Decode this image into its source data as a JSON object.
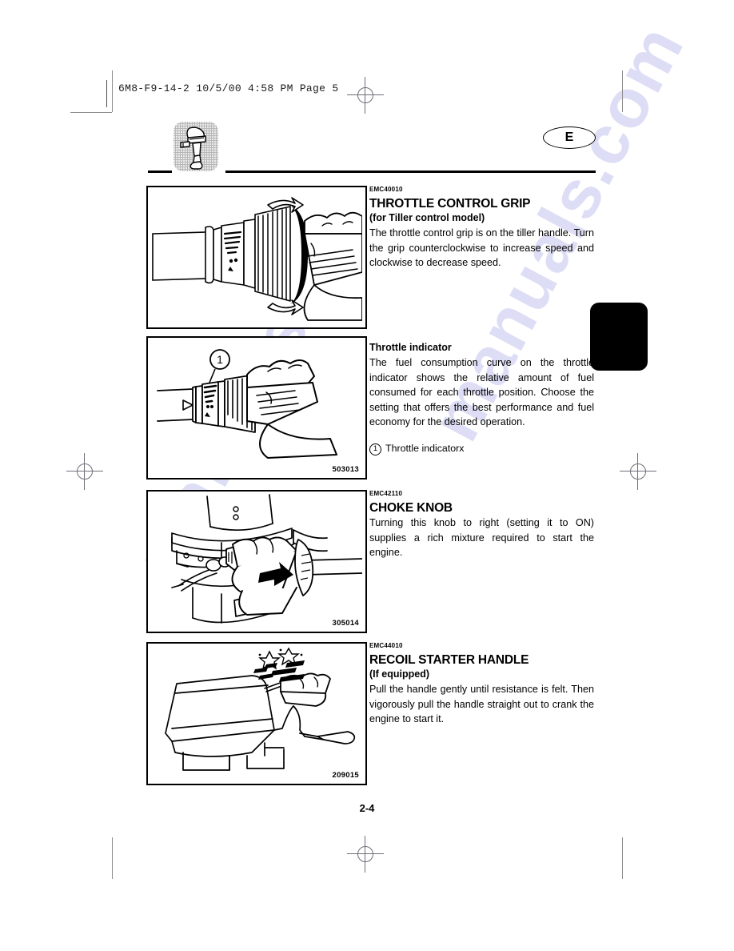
{
  "scan_header": {
    "text": "6M8-F9-14-2  10/5/00 4:58 PM  Page 5"
  },
  "masthead": {
    "icon": "outboard-motor-icon",
    "language_badge": "E"
  },
  "watermark": {
    "line_a": "manualsit",
    "line_b": "manuals.com"
  },
  "page_number": "2-4",
  "sections": [
    {
      "ref_code": "EMC40010",
      "title": "THROTTLE CONTROL GRIP",
      "subtitle": "(for Tiller control model)",
      "body": "The throttle control grip is on the tiller handle. Turn the grip counterclockwise to increase speed and clockwise to decrease speed.",
      "figure_id": "",
      "figure_name": "throttle-control-grip-illustration"
    },
    {
      "ref_code": "",
      "title": "",
      "subtitle": "Throttle indicator",
      "body": "The fuel consumption curve on the throttle indicator shows the relative amount of fuel consumed for each throttle position. Choose the setting that offers the best performance and fuel economy for the desired operation.",
      "callout_number": "1",
      "callout_label": "Throttle indicatorx",
      "figure_id": "503013",
      "figure_name": "throttle-indicator-illustration"
    },
    {
      "ref_code": "EMC42110",
      "title": "CHOKE KNOB",
      "subtitle": "",
      "body": "Turning this knob to right (setting it to ON) supplies a rich mixture required to start the engine.",
      "figure_id": "305014",
      "figure_name": "choke-knob-illustration"
    },
    {
      "ref_code": "EMC44010",
      "title": "RECOIL STARTER HANDLE",
      "subtitle": "(If equipped)",
      "body": "Pull the handle gently until resistance is felt. Then vigorously pull the handle straight out to crank the engine to start it.",
      "figure_id": "209015",
      "figure_name": "recoil-starter-handle-illustration"
    }
  ],
  "colors": {
    "ink": "#000000",
    "badge_gray": "#b8b8b8",
    "watermark": "#c9cbef",
    "mark_gray": "#6e6e7a"
  }
}
